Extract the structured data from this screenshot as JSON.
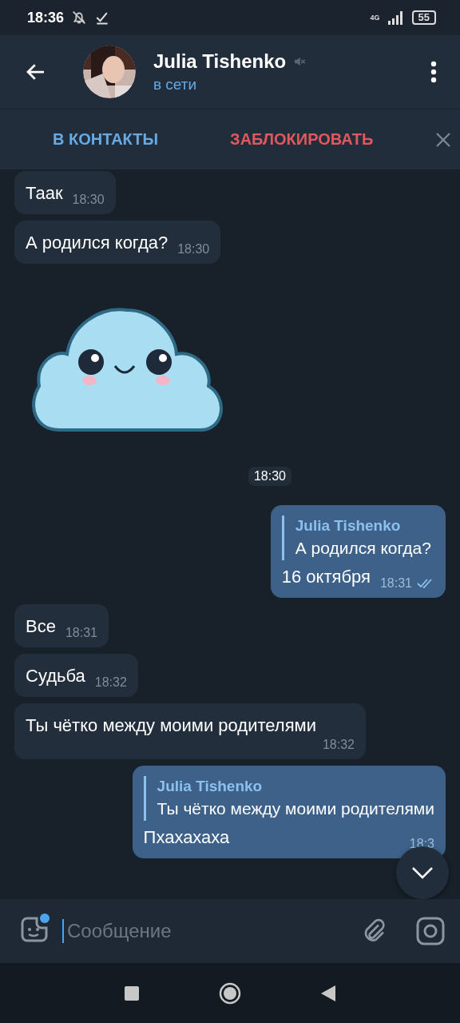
{
  "status_bar": {
    "time": "18:36",
    "network": "4G",
    "battery": "55"
  },
  "header": {
    "name": "Julia Tishenko",
    "muted": true,
    "status": "в сети"
  },
  "action_bar": {
    "add_contact": "В КОНТАКТЫ",
    "block": "ЗАБЛОКИРОВАТЬ"
  },
  "messages": [
    {
      "kind": "text",
      "outgoing": false,
      "text": "Таак",
      "time": "18:30"
    },
    {
      "kind": "text",
      "outgoing": false,
      "text": "А родился когда?",
      "time": "18:30"
    },
    {
      "kind": "sticker",
      "outgoing": false,
      "time": "18:30"
    },
    {
      "kind": "reply",
      "outgoing": true,
      "reply_author": "Julia Tishenko",
      "reply_text": "А родился когда?",
      "text": "16 октября",
      "time": "18:31",
      "read": true
    },
    {
      "kind": "text",
      "outgoing": false,
      "text": "Все",
      "time": "18:31"
    },
    {
      "kind": "text",
      "outgoing": false,
      "text": "Судьба",
      "time": "18:32"
    },
    {
      "kind": "text",
      "outgoing": false,
      "text": "Ты чётко между моими родителями",
      "time": "18:32"
    },
    {
      "kind": "reply",
      "outgoing": true,
      "reply_author": "Julia Tishenko",
      "reply_text": "Ты чётко между моими родителями",
      "text": "Пхахахаха",
      "time": "18:3"
    }
  ],
  "composer": {
    "placeholder": "Сообщение"
  }
}
